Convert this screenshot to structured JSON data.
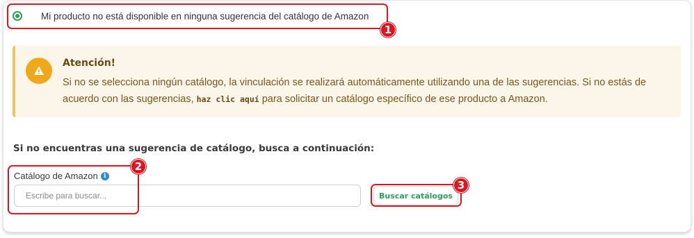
{
  "option": {
    "label": "Mi producto no está disponible en ninguna sugerencia del catálogo de Amazon",
    "selected": true
  },
  "alert": {
    "title": "Atención!",
    "body_part1": "Si no se selecciona ningún catálogo, la vinculación se realizará automáticamente utilizando una de las sugerencias. Si no estás de acuerdo con las sugerencias, ",
    "link_text": "haz clic aquí",
    "body_part2": " para solicitar un catálogo específico de ese producto a Amazon."
  },
  "search": {
    "heading": "Si no encuentras una sugerencia de catálogo, busca a continuación:",
    "field_label": "Catálogo de Amazon",
    "placeholder": "Escribe para buscar...",
    "value": "",
    "button_label": "Buscar catálogos"
  },
  "annotations": [
    {
      "number": "1"
    },
    {
      "number": "2"
    },
    {
      "number": "3"
    }
  ],
  "colors": {
    "accent_green": "#2e9e5b",
    "annotation_red": "#e0141e",
    "alert_background": "#fbf6e9",
    "alert_icon": "#f0a81b",
    "info_icon": "#2a8fd6"
  },
  "icons": {
    "radio": "radio-selected-icon",
    "alert": "warning-icon",
    "info": "info-icon"
  }
}
